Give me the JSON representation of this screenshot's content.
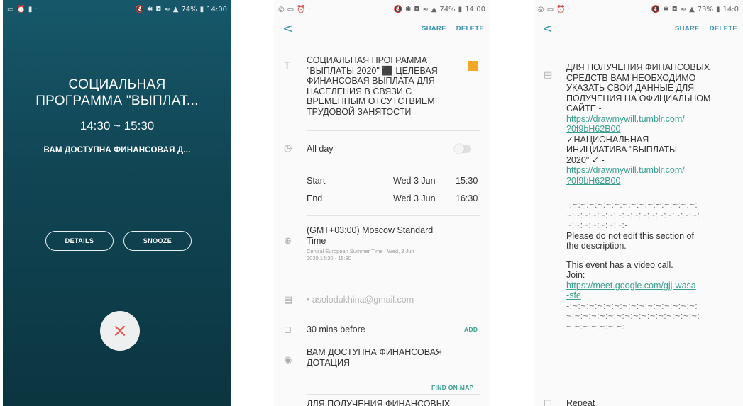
{
  "status1": {
    "battery": "74%",
    "time": "14:00"
  },
  "status2": {
    "battery": "74%",
    "time": "14:00"
  },
  "status3": {
    "battery": "73%",
    "time": "14:0"
  },
  "alarm": {
    "title_line1": "СОЦИАЛЬНАЯ",
    "title_line2": "ПРОГРАММА \"ВЫПЛАТ...",
    "time_range": "14:30 ~ 15:30",
    "description": "ВАМ ДОСТУПНА ФИНАНСОВАЯ Д...",
    "details_label": "DETAILS",
    "snooze_label": "SNOOZE",
    "dismiss_icon": "×"
  },
  "toolbar": {
    "back": "<",
    "share": "SHARE",
    "delete": "DELETE"
  },
  "event": {
    "title": [
      "СОЦИАЛЬНАЯ ПРОГРАММА",
      "\"ВЫПЛАТЫ 2020\" ⬛ ЦЕЛЕВАЯ",
      "ФИНАНСОВАЯ ВЫПЛАТА ДЛЯ",
      "НАСЕЛЕНИЯ В СВЯЗИ С",
      "ВРЕМЕННЫМ ОТСУТСТВИЕМ",
      "ТРУДОВОЙ ЗАНЯТОСТИ"
    ],
    "color_swatch": "#f5a623",
    "all_day_label": "All day",
    "start_label": "Start",
    "start_date": "Wed 3 Jun",
    "start_time": "15:30",
    "end_label": "End",
    "end_date": "Wed 3 Jun",
    "end_time": "16:30",
    "timezone_line1": "(GMT+03:00) Moscow Standard",
    "timezone_line2": "Time",
    "timezone_sub1": "Central European Summer Time : Wed, 3 Jun",
    "timezone_sub2": "2020 14:30 - 15:30",
    "calendar_account": "• asolodukhina@gmail.com",
    "reminder": "30 mins before",
    "add_label": "ADD",
    "location_line1": "ВАМ ДОСТУПНА ФИНАНСОВАЯ",
    "location_line2": "ДОТАЦИЯ",
    "find_on_map": "FIND ON MAP",
    "desc_peek": "ДЛЯ ПОЛУЧЕНИЯ ФИНАНСОВЫХ"
  },
  "description": {
    "lines": [
      "ДЛЯ ПОЛУЧЕНИЯ ФИНАНСОВЫХ",
      "СРЕДСТВ ВАМ НЕОБХОДИМО",
      "УКАЗАТЬ СВОИ ДАННЫЕ ДЛЯ",
      "ПОЛУЧЕНИЯ НА ОФИЦИАЛЬНОМ",
      "САЙТЕ -"
    ],
    "link1_line1": "https://drawmywill.tumblr.com/",
    "link1_line2": "?0f9bH62B00",
    "initiative_line1": "✓НАЦИОНАЛЬНАЯ",
    "initiative_line2": "ИНИЦИАТИВА \"ВЫПЛАТЫ",
    "initiative_line3": "2020\" ✓ -",
    "link2_line1": "https://drawmywill.tumblr.com/",
    "link2_line2": "?0f9bH62B00",
    "sep_line1": "-:~:~:~:~:~:~:~:~:~:~:~:~:~:~:~:",
    "sep_line2": "~:~:~:~:~:~:~:~:~:~:~:~:~:~:~:~:",
    "sep_line3": "~:~:~:~:~:~:~:-",
    "notice_line1": "Please do not edit this section of",
    "notice_line2": "the description.",
    "video_line1": "This event has a video call.",
    "video_line2": "Join:",
    "meet_line1": "https://meet.google.com/gjj-wasa",
    "meet_line2": "-sfe",
    "sep2_line1": "-:~:~:~:~:~:~:~:~:~:~:~:~:~:~:~:",
    "sep2_line2": "~:~:~:~:~:~:~:~:~:~:~:~:~:~:~:~:",
    "sep2_line3": "~:~:~:~:~:~:~:-",
    "repeat_label": "Repeat"
  }
}
